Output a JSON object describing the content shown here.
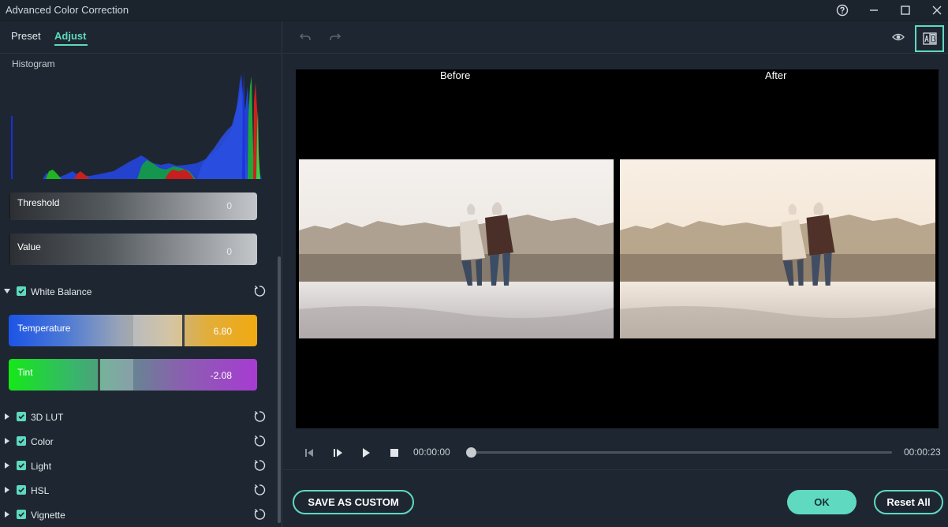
{
  "window": {
    "title": "Advanced Color Correction"
  },
  "tabs": {
    "preset": "Preset",
    "adjust": "Adjust"
  },
  "histogram": {
    "label": "Histogram"
  },
  "sliders": {
    "threshold": {
      "label": "Threshold",
      "value": "0"
    },
    "value": {
      "label": "Value",
      "value": "0"
    },
    "temperature": {
      "label": "Temperature",
      "value": "6.80"
    },
    "tint": {
      "label": "Tint",
      "value": "-2.08"
    }
  },
  "sections": {
    "white_balance": "White Balance",
    "lut": "3D LUT",
    "color": "Color",
    "light": "Light",
    "hsl": "HSL",
    "vignette": "Vignette"
  },
  "preview": {
    "before": "Before",
    "after": "After"
  },
  "transport": {
    "current_time": "00:00:00",
    "total_time": "00:00:23",
    "progress": 0
  },
  "buttons": {
    "save_custom": "SAVE AS CUSTOM",
    "ok": "OK",
    "reset_all": "Reset All"
  },
  "colors": {
    "accent": "#5fd9c0",
    "background": "#1e2731"
  },
  "icons": [
    "help-icon",
    "minimize-icon",
    "maximize-icon",
    "close-icon",
    "undo-icon",
    "redo-icon",
    "eye-icon",
    "ab-compare-icon",
    "prev-frame-icon",
    "play-frame-icon",
    "play-icon",
    "stop-icon",
    "reset-icon",
    "checkbox-icon",
    "triangle-icon"
  ]
}
